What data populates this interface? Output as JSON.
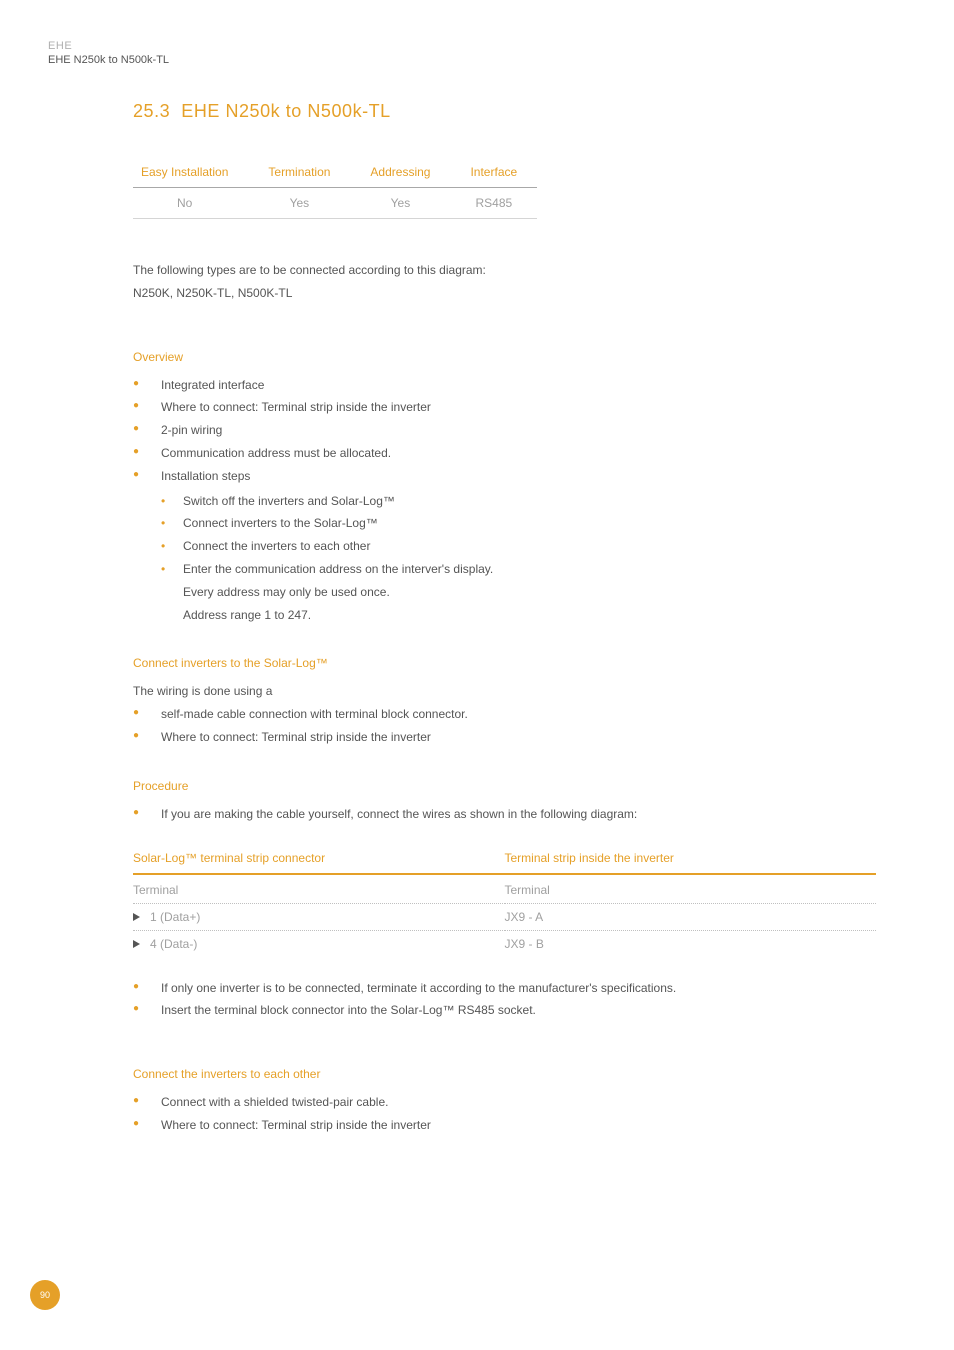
{
  "header": {
    "line1": "EHE",
    "line2": "EHE N250k to N500k-TL"
  },
  "section": {
    "number": "25.3",
    "title": "EHE N250k to N500k-TL"
  },
  "spec": {
    "headers": [
      "Easy Installation",
      "Termination",
      "Addressing",
      "Interface"
    ],
    "row": [
      "No",
      "Yes",
      "Yes",
      "RS485"
    ]
  },
  "intro": {
    "line1": "The following types are to be connected according to this diagram:",
    "line2": "N250K, N250K-TL, N500K-TL"
  },
  "overview": {
    "title": "Overview",
    "items": [
      "Integrated interface",
      "Where to connect: Terminal strip inside the inverter",
      "2-pin wiring",
      "Communication address must be allocated.",
      "Installation steps"
    ],
    "steps": [
      "Switch off the inverters and Solar-Log™",
      "Connect inverters to the Solar-Log™",
      "Connect the inverters to each other"
    ],
    "step4_l1": "Enter the communication address on the interver's display.",
    "step4_l2": "Every address may only be used once.",
    "step4_l3": "Address range 1 to 247."
  },
  "connect_sl": {
    "title": "Connect inverters to the Solar-Log™",
    "intro": "The wiring is done using a",
    "items": [
      "self-made cable connection with terminal block connector.",
      "Where to connect: Terminal strip inside the inverter"
    ]
  },
  "procedure": {
    "title": "Procedure",
    "item1": "If you are making the cable yourself, connect the wires as shown in the following diagram:"
  },
  "wiring": {
    "col1_header": "Solar-Log™ terminal strip connector",
    "col2_header": "Terminal strip inside the inverter",
    "sub1": "Terminal",
    "sub2": "Terminal",
    "rows": [
      {
        "a": "1 (Data+)",
        "b": "JX9 - A"
      },
      {
        "a": "4 (Data-)",
        "b": "JX9 - B"
      }
    ]
  },
  "after_table": {
    "items": [
      "If only one inverter is to be connected, terminate it  according to the manufacturer's specifications.",
      "Insert the terminal block connector into the Solar-Log™ RS485 socket."
    ]
  },
  "connect_each": {
    "title": "Connect the inverters to each other",
    "items": [
      "Connect with a shielded twisted-pair cable.",
      "Where to connect: Terminal strip inside the inverter"
    ]
  },
  "page_number": "90"
}
